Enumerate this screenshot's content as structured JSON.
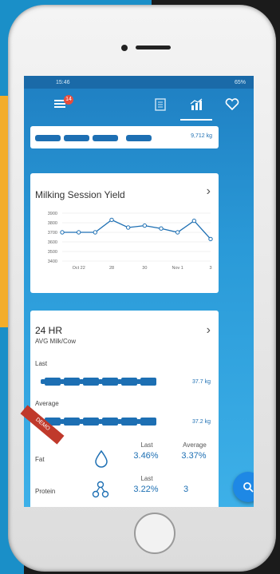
{
  "status": {
    "left": "15:46",
    "right": "65%"
  },
  "app": {
    "badge": "14"
  },
  "strip": {
    "value": "9,712 kg"
  },
  "yield_card": {
    "title": "Milking Session Yield"
  },
  "chart_data": {
    "type": "line",
    "title": "Milking Session Yield",
    "x_tick_labels": [
      "Oct 22",
      "28",
      "30",
      "Nov 1",
      "3"
    ],
    "y_tick_labels": [
      "3900",
      "3800",
      "3700",
      "3600",
      "3500",
      "3400"
    ],
    "ylim": [
      3400,
      3900
    ],
    "series": [
      {
        "values": [
          3700,
          3700,
          3700,
          3830,
          3750,
          3770,
          3740,
          3700,
          3820,
          3630
        ]
      }
    ],
    "grid": true
  },
  "stats": {
    "title": "24 HR",
    "subtitle": "AVG Milk/Cow",
    "last_label": "Last",
    "last_value": "37.7 kg",
    "avg_label": "Average",
    "avg_value": "37.2 kg",
    "col_last": "Last",
    "col_avg": "Average",
    "fat_label": "Fat",
    "fat_last": "3.46%",
    "fat_avg": "3.37%",
    "protein_label": "Protein",
    "protein_last": "3.22%",
    "protein_avg": "3"
  },
  "ribbon": {
    "text": "DEMO"
  },
  "colors": {
    "primary": "#1d6fb3",
    "accent": "#1e88e5",
    "badge": "#e74c3c"
  }
}
